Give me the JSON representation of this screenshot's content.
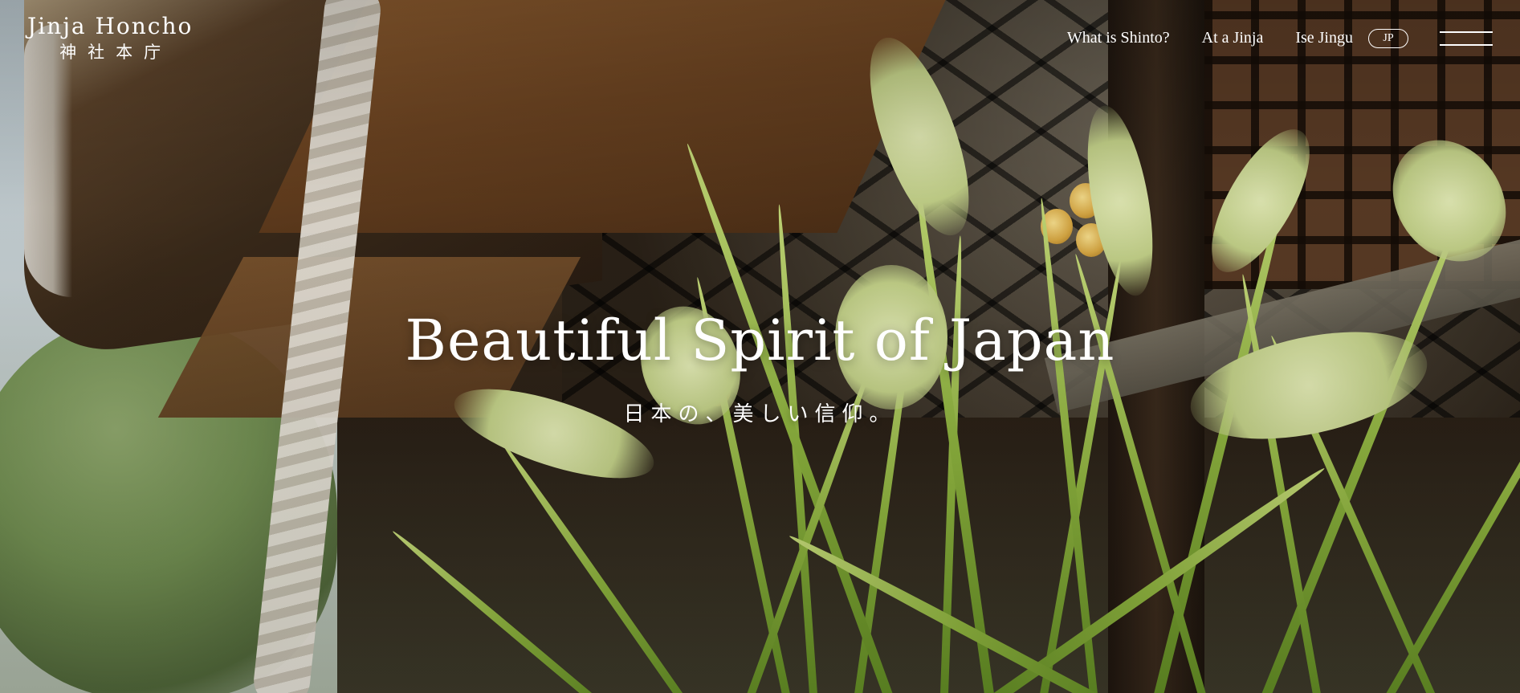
{
  "header": {
    "logo": {
      "en": "Jinja Honcho",
      "ja": "神社本庁"
    },
    "nav": [
      {
        "label": "What is Shinto?"
      },
      {
        "label": "At a Jinja"
      },
      {
        "label": "Ise Jingu"
      }
    ],
    "language_toggle": "JP",
    "menu_icon": "hamburger-menu-icon"
  },
  "hero": {
    "title": "Beautiful Spirit of Japan",
    "subtitle": "日本の、美しい信仰。",
    "background": "shrine-roof-and-rice-plants"
  },
  "colors": {
    "text": "#ffffff",
    "grass": "#8fb43f",
    "wood": "#6b4321"
  }
}
